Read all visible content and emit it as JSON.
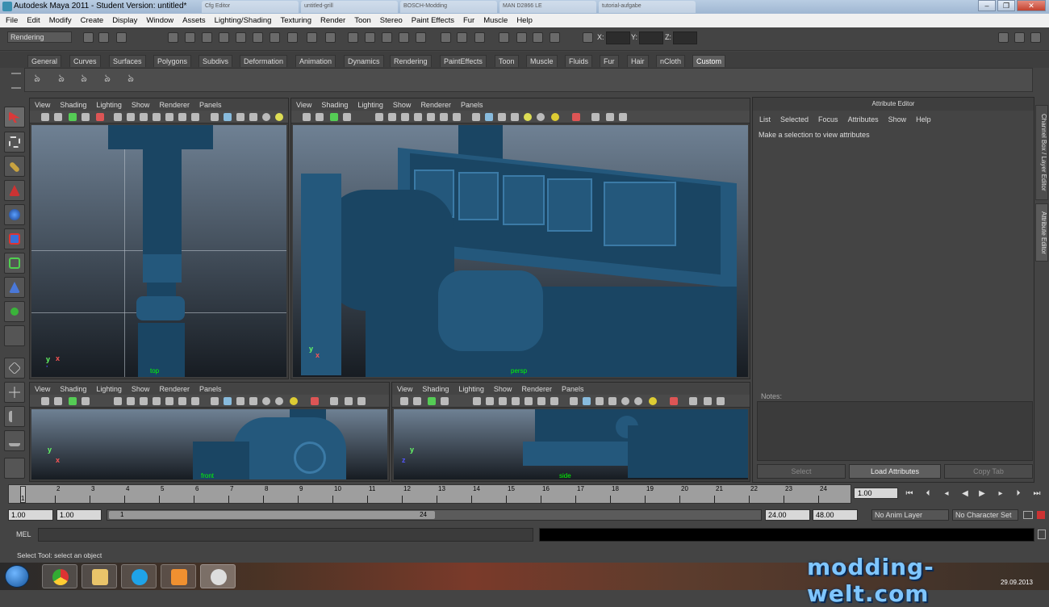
{
  "window": {
    "title": "Autodesk Maya 2011 - Student Version: untitled*",
    "ghost_tabs": [
      "Cfg Editor",
      "untitled-grill",
      "BOSCH-Modding",
      "MAN D2866 LE",
      "tutorial-aufgabe"
    ]
  },
  "menubar": [
    "File",
    "Edit",
    "Modify",
    "Create",
    "Display",
    "Window",
    "Assets",
    "Lighting/Shading",
    "Texturing",
    "Render",
    "Toon",
    "Stereo",
    "Paint Effects",
    "Fur",
    "Muscle",
    "Help"
  ],
  "status_line": {
    "mode": "Rendering",
    "x_label": "X:",
    "y_label": "Y:",
    "z_label": "Z:"
  },
  "shelf": {
    "tabs": [
      "General",
      "Curves",
      "Surfaces",
      "Polygons",
      "Subdivs",
      "Deformation",
      "Animation",
      "Dynamics",
      "Rendering",
      "PaintEffects",
      "Toon",
      "Muscle",
      "Fluids",
      "Fur",
      "Hair",
      "nCloth",
      "Custom"
    ],
    "active_tab": "Custom"
  },
  "panel_menu": [
    "View",
    "Shading",
    "Lighting",
    "Show",
    "Renderer",
    "Panels"
  ],
  "viewports": {
    "top_left": {
      "camera": "top"
    },
    "top_right": {
      "camera": "persp"
    },
    "bottom_left": {
      "camera": "front"
    },
    "bottom_right": {
      "camera": "side"
    }
  },
  "attribute_editor": {
    "title": "Attribute Editor",
    "menu": [
      "List",
      "Selected",
      "Focus",
      "Attributes",
      "Show",
      "Help"
    ],
    "message": "Make a selection to view attributes",
    "notes_label": "Notes:",
    "buttons": {
      "select": "Select",
      "load": "Load Attributes",
      "copy": "Copy Tab"
    }
  },
  "side_tabs": {
    "channel_box": "Channel Box / Layer Editor",
    "attribute_editor": "Attribute Editor"
  },
  "time_slider": {
    "ticks": [
      "1",
      "2",
      "3",
      "4",
      "5",
      "6",
      "7",
      "8",
      "9",
      "10",
      "11",
      "12",
      "13",
      "14",
      "15",
      "16",
      "17",
      "18",
      "19",
      "20",
      "21",
      "22",
      "23",
      "24"
    ],
    "current_frame": "1.00",
    "current_marker": "1"
  },
  "range_slider": {
    "start": "1.00",
    "playback_start": "1.00",
    "handle_left": "1",
    "handle_right": "24",
    "playback_end": "24.00",
    "end": "48.00",
    "anim_layer": "No Anim Layer",
    "character_set": "No Character Set"
  },
  "command_line": {
    "label": "MEL"
  },
  "help_line": "Select Tool: select an object",
  "watermark": "modding-welt.com",
  "clock": {
    "date": "29.09.2013"
  }
}
